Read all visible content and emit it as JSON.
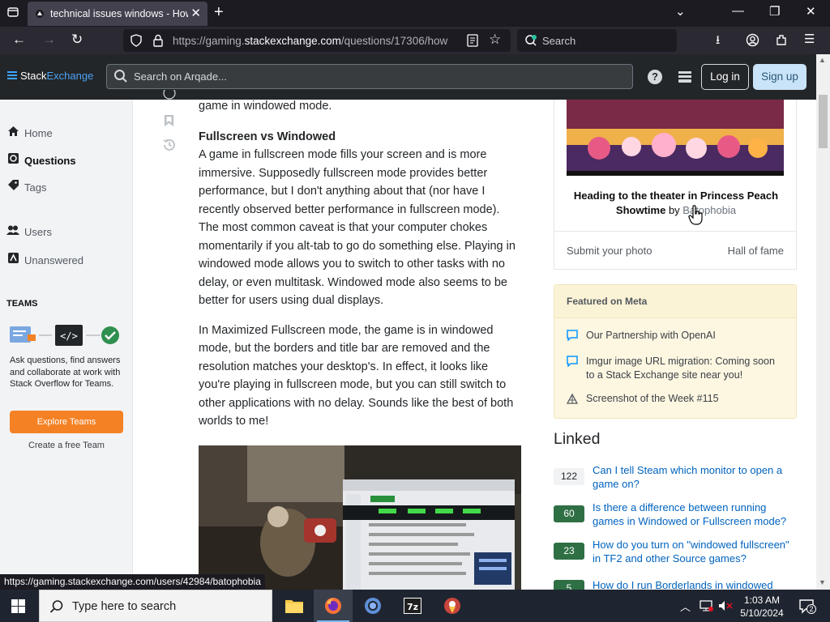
{
  "browser": {
    "tab_title": "technical issues windows - How",
    "url_prefix": "https://gaming.",
    "url_domain": "stackexchange.com",
    "url_rest": "/questions/17306/how",
    "search_placeholder": "Search",
    "status_url": "https://gaming.stackexchange.com/users/42984/batophobia"
  },
  "topbar": {
    "logo_a": "Stack",
    "logo_b": "Exchange",
    "search_placeholder": "Search on Arqade...",
    "login": "Log in",
    "signup": "Sign up"
  },
  "sidebar": {
    "items": [
      {
        "label": "Home",
        "icon": "home-icon"
      },
      {
        "label": "Questions",
        "icon": "globe-icon"
      },
      {
        "label": "Tags",
        "icon": "tag-icon"
      },
      {
        "label": "Users",
        "icon": "users-icon"
      },
      {
        "label": "Unanswered",
        "icon": "unanswered-icon"
      }
    ],
    "teams_heading": "TEAMS",
    "teams_text": "Ask questions, find answers and collaborate at work with Stack Overflow for Teams.",
    "explore_button": "Explore Teams",
    "create_team": "Create a free Team"
  },
  "post": {
    "intro_tail": "game in windowed mode.",
    "heading": "Fullscreen vs Windowed",
    "para1": "A game in fullscreen mode fills your screen and is more immersive. Supposedly fullscreen mode provides better performance, but I don't anything about that (nor have I recently observed better performance in fullscreen mode). The most common caveat is that your computer chokes momentarily if you alt-tab to go do something else. Playing in windowed mode allows you to switch to other tasks with no delay, or even multitask. Windowed mode also seems to be better for users using dual displays.",
    "para2": "In Maximized Fullscreen mode, the game is in windowed mode, but the borders and title bar are removed and the resolution matches your desktop's. In effect, it looks like you're playing in fullscreen mode, but you can still switch to other applications with no delay. Sounds like the best of both worlds to me!"
  },
  "photo": {
    "caption_title": "Heading to the theater in Princess Peach Showtime",
    "by": "by",
    "author": "Batophobia",
    "submit": "Submit your photo",
    "hall": "Hall of fame"
  },
  "meta": {
    "heading": "Featured on Meta",
    "items": [
      "Our Partnership with OpenAI",
      "Imgur image URL migration: Coming soon to a Stack Exchange site near you!",
      "Screenshot of the Week #115"
    ]
  },
  "linked": {
    "heading": "Linked",
    "items": [
      {
        "count": "122",
        "title": "Can I tell Steam which monitor to open a game on?"
      },
      {
        "count": "60",
        "title": "Is there a difference between running games in Windowed or Fullscreen mode?"
      },
      {
        "count": "23",
        "title": "How do you turn on \"windowed fullscreen\" in TF2 and other Source games?"
      },
      {
        "count": "5",
        "title": "How do I run Borderlands in windowed"
      }
    ]
  },
  "taskbar": {
    "search_placeholder": "Type here to search",
    "time": "1:03 AM",
    "date": "5/10/2024",
    "notifications": "2"
  }
}
